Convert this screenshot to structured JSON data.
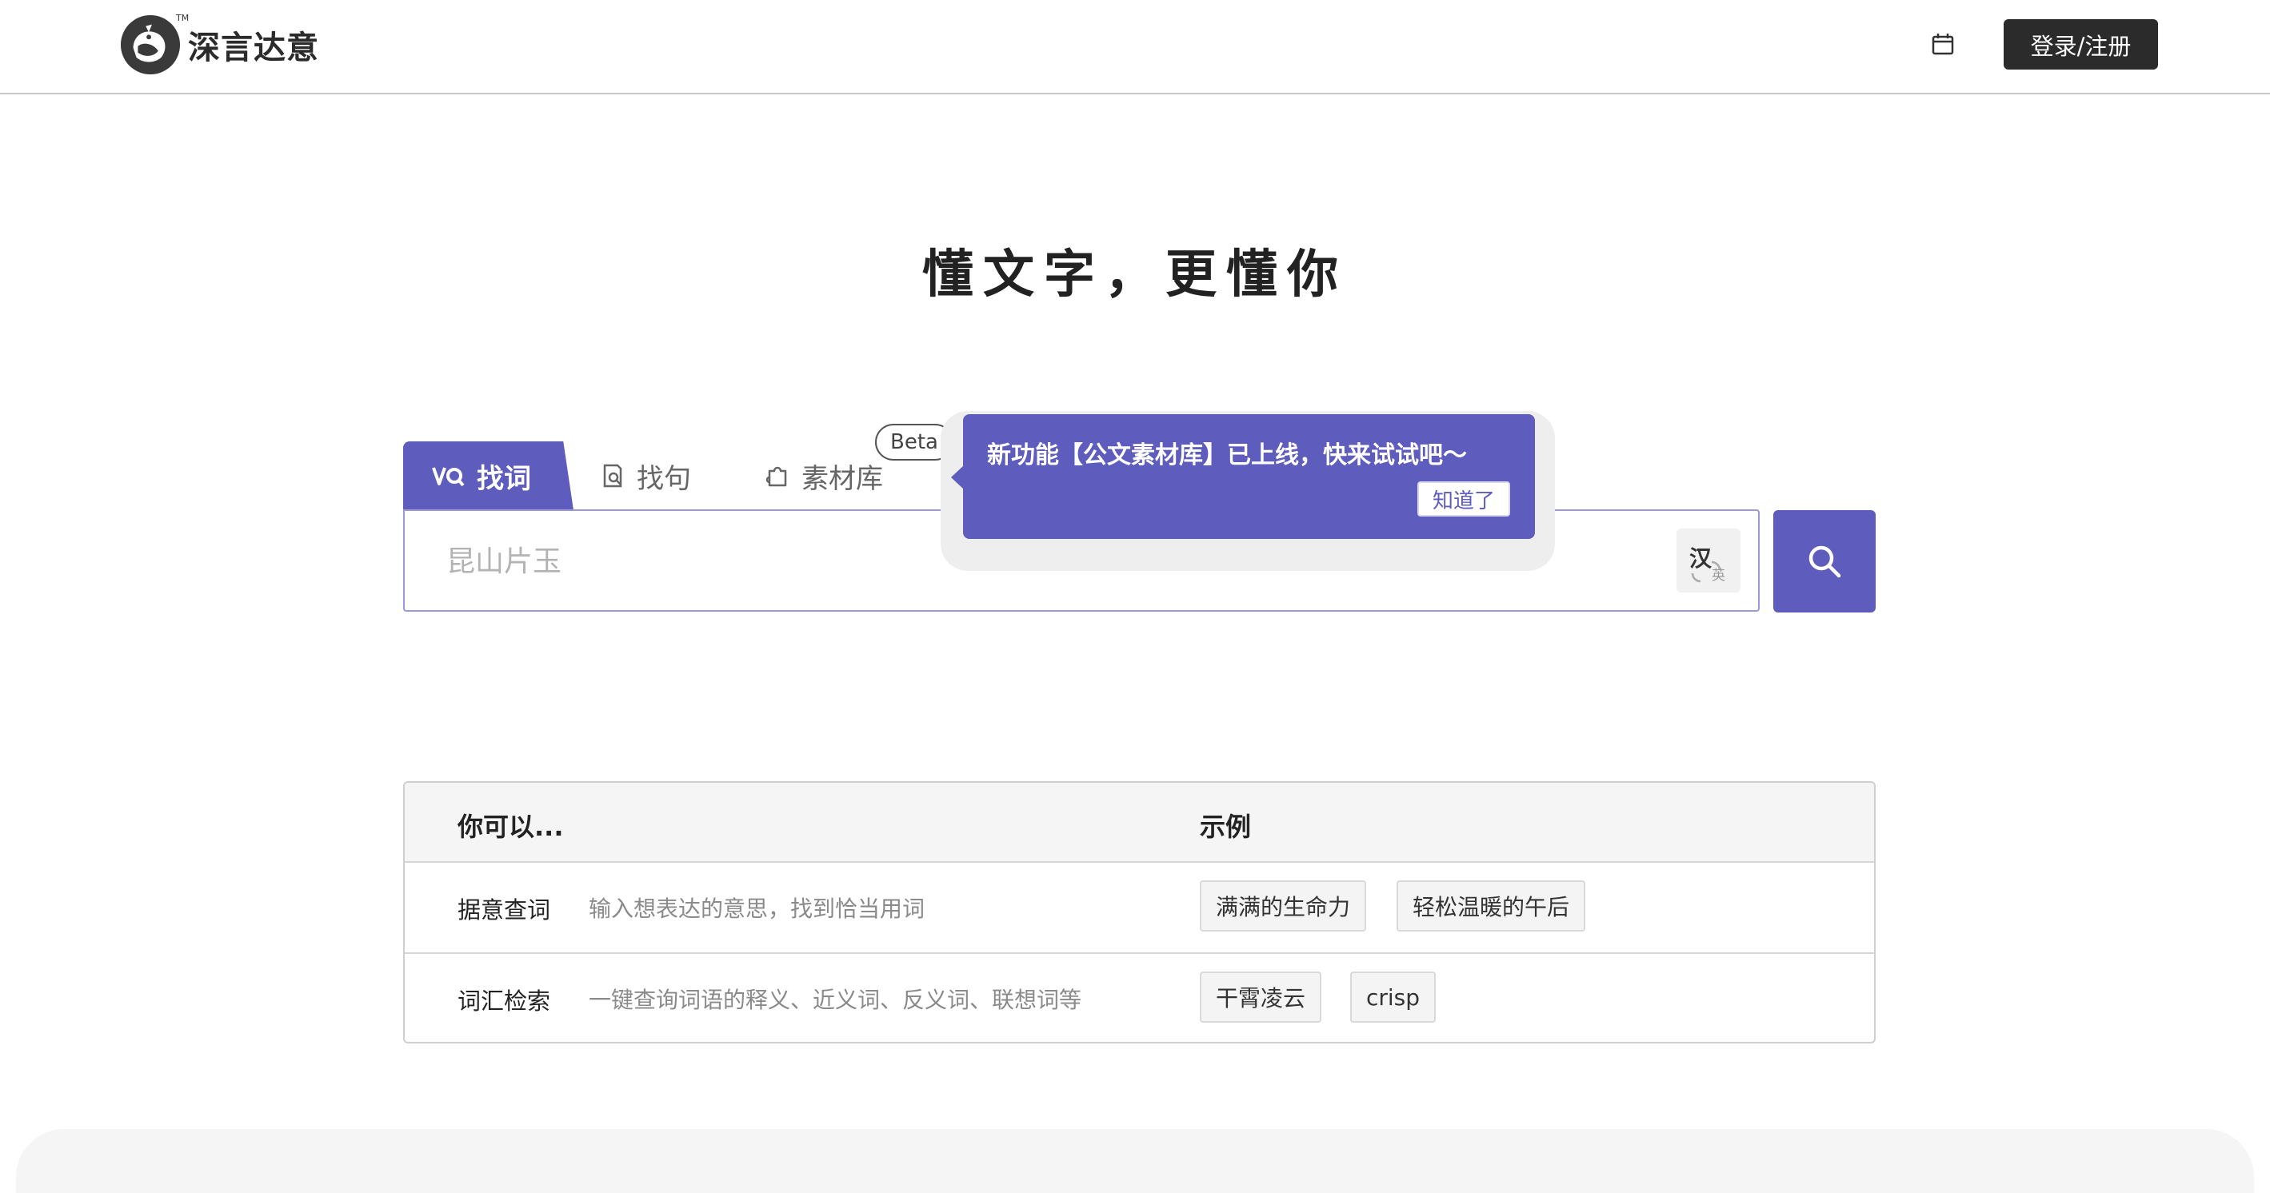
{
  "header": {
    "logo_text": "深言达意",
    "logo_tm": "TM",
    "login_label": "登录/注册"
  },
  "slogan": "懂文字，更懂你",
  "tabs": [
    {
      "label": "找词",
      "active": true,
      "icon": "word-search-icon"
    },
    {
      "label": "找句",
      "active": false,
      "icon": "sentence-search-icon"
    },
    {
      "label": "素材库",
      "active": false,
      "icon": "puzzle-icon"
    }
  ],
  "beta_badge": "Beta",
  "search": {
    "placeholder": "昆山片玉",
    "value": "",
    "lang_zh": "汉",
    "lang_en": "英"
  },
  "tooltip": {
    "message": "新功能【公文素材库】已上线，快来试试吧～",
    "button": "知道了"
  },
  "features": {
    "header": {
      "col1": "你可以...",
      "col2": "示例"
    },
    "rows": [
      {
        "name": "据意查词",
        "desc": "输入想表达的意思，找到恰当用词",
        "examples": [
          "满满的生命力",
          "轻松温暖的午后"
        ]
      },
      {
        "name": "词汇检索",
        "desc": "一键查询词语的释义、近义词、反义词、联想词等",
        "examples": [
          "干霄凌云",
          "crisp"
        ]
      }
    ]
  },
  "colors": {
    "accent": "#5e5cbd",
    "dark": "#2b2b2b",
    "muted": "#8a8a8a"
  }
}
